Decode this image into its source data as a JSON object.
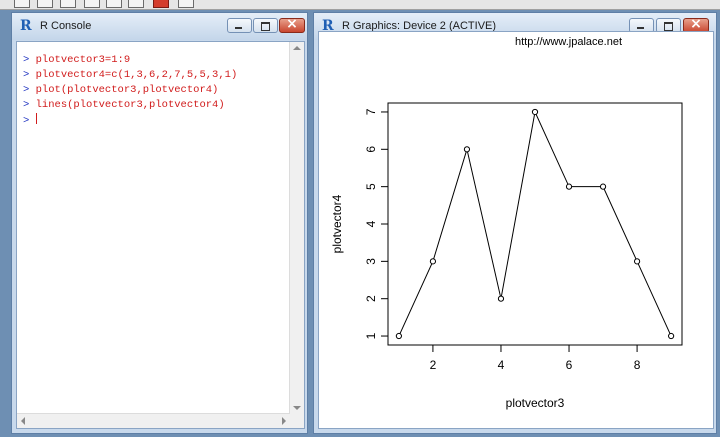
{
  "console_window": {
    "title": "R Console",
    "prompt": ">",
    "lines": [
      "plotvector3=1:9",
      "plotvector4=c(1,3,6,2,7,5,5,3,1)",
      "plot(plotvector3,plotvector4)",
      "lines(plotvector3,plotvector4)"
    ],
    "app_icon": "r-logo-icon"
  },
  "graphics_window": {
    "title": "R Graphics: Device 2 (ACTIVE)",
    "watermark": "http://www.jpalace.net",
    "app_icon": "r-logo-icon"
  },
  "colors": {
    "console_command": "#d11c1c",
    "console_prompt": "#1b2fc0",
    "plot_line": "#000000"
  },
  "chart_data": {
    "type": "line",
    "markers": "open-circle",
    "x": [
      1,
      2,
      3,
      4,
      5,
      6,
      7,
      8,
      9
    ],
    "y": [
      1,
      3,
      6,
      2,
      7,
      5,
      5,
      3,
      1
    ],
    "xlabel": "plotvector3",
    "ylabel": "plotvector4",
    "x_ticks": [
      2,
      4,
      6,
      8
    ],
    "y_ticks": [
      1,
      2,
      3,
      4,
      5,
      6,
      7
    ],
    "xlim": [
      0.68,
      9.32
    ],
    "ylim": [
      0.76,
      7.24
    ],
    "grid": false,
    "box": true
  }
}
